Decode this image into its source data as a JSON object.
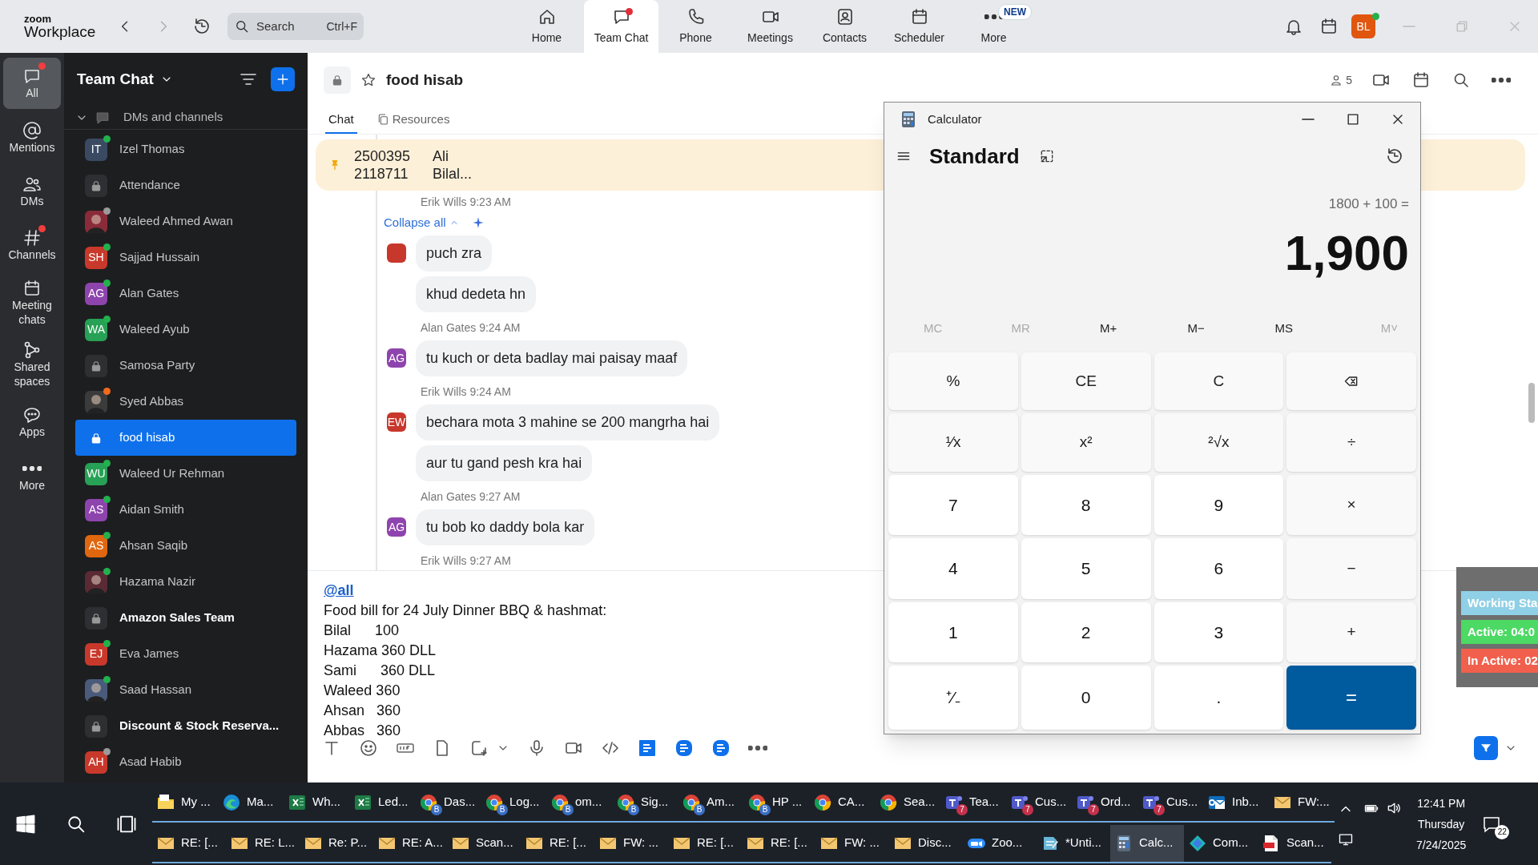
{
  "app": {
    "logo_top": "zoom",
    "logo_bottom": "Workplace",
    "search": {
      "placeholder": "Search",
      "shortcut": "Ctrl+F"
    }
  },
  "nav": [
    {
      "label": "Home",
      "selected": false,
      "dot": false
    },
    {
      "label": "Team Chat",
      "selected": true,
      "dot": true
    },
    {
      "label": "Phone",
      "selected": false,
      "dot": false
    },
    {
      "label": "Meetings",
      "selected": false,
      "dot": false
    },
    {
      "label": "Contacts",
      "selected": false,
      "dot": false
    },
    {
      "label": "Scheduler",
      "selected": false,
      "dot": false
    },
    {
      "label": "More",
      "selected": false,
      "dot": false,
      "badge": "NEW"
    }
  ],
  "account": {
    "initials": "BL"
  },
  "rail": [
    {
      "label": "All",
      "selected": true,
      "dot": true
    },
    {
      "label": "Mentions",
      "selected": false,
      "dot": false
    },
    {
      "label": "DMs",
      "selected": false,
      "dot": false
    },
    {
      "label": "Channels",
      "selected": false,
      "dot": true
    },
    {
      "label": "Meeting chats",
      "selected": false,
      "dot": false
    },
    {
      "label": "Shared spaces",
      "selected": false,
      "dot": false
    },
    {
      "label": "Apps",
      "selected": false,
      "dot": false
    },
    {
      "label": "More",
      "selected": false,
      "dot": false
    }
  ],
  "sidebar": {
    "title": "Team Chat",
    "section": "DMs and channels",
    "items": [
      {
        "name": "Izel Thomas",
        "kind": "initials",
        "initials": "IT",
        "color": "#3a4a63",
        "presence": {
          "color": "#22b14c"
        },
        "selected": false,
        "unread": false
      },
      {
        "name": "Attendance",
        "kind": "channel",
        "selected": false,
        "unread": false
      },
      {
        "name": "Waleed Ahmed Awan",
        "color": "#8a2b3a",
        "presence": {
          "color": "#9a9a9a"
        },
        "selected": false,
        "unread": false
      },
      {
        "name": "Sajjad Hussain",
        "kind": "initials",
        "initials": "SH",
        "color": "#c8392b",
        "presence": {
          "color": "#22b14c"
        },
        "selected": false,
        "unread": false
      },
      {
        "name": "Alan Gates",
        "kind": "initials",
        "initials": "AG",
        "color": "#8e44ad",
        "presence": {
          "color": "#22b14c"
        },
        "selected": false,
        "unread": false
      },
      {
        "name": "Waleed Ayub",
        "kind": "initials",
        "initials": "WA",
        "color": "#27a155",
        "presence": {
          "color": "#22b14c"
        },
        "selected": false,
        "unread": false
      },
      {
        "name": "Samosa Party",
        "kind": "channel",
        "selected": false,
        "unread": false
      },
      {
        "name": "Syed Abbas",
        "color": "#3b3b3b",
        "presence": {
          "color": "#f26a1b"
        },
        "selected": false,
        "unread": false
      },
      {
        "name": "food hisab",
        "kind": "channel",
        "selected": true,
        "unread": false
      },
      {
        "name": "Waleed Ur Rehman",
        "kind": "initials",
        "initials": "WU",
        "color": "#27a155",
        "presence": {
          "color": "#22b14c"
        },
        "selected": false,
        "unread": false
      },
      {
        "name": "Aidan Smith",
        "kind": "initials",
        "initials": "AS",
        "color": "#8e44ad",
        "presence": {
          "color": "#22b14c"
        },
        "selected": false,
        "unread": false
      },
      {
        "name": "Ahsan Saqib",
        "kind": "initials",
        "initials": "AS",
        "color": "#e0670f",
        "presence": {
          "color": "#22b14c"
        },
        "selected": false,
        "unread": false
      },
      {
        "name": "Hazama Nazir",
        "color": "#5a2a35",
        "presence": {
          "color": "#22b14c"
        },
        "selected": false,
        "unread": false
      },
      {
        "name": "Amazon Sales Team",
        "kind": "channel",
        "selected": false,
        "unread": true
      },
      {
        "name": "Eva James",
        "kind": "initials",
        "initials": "EJ",
        "color": "#c8392b",
        "presence": {
          "color": "#22b14c"
        },
        "selected": false,
        "unread": false
      },
      {
        "name": "Saad Hassan",
        "color": "#4a5a7a",
        "presence": {
          "color": "#22b14c"
        },
        "selected": false,
        "unread": false
      },
      {
        "name": "Discount & Stock Reserva...",
        "kind": "channel",
        "selected": false,
        "unread": true
      },
      {
        "name": "Asad Habib",
        "kind": "initials",
        "initials": "AH",
        "color": "#c8392b",
        "presence": {
          "color": "#9a9a9a"
        },
        "selected": false,
        "unread": false
      }
    ]
  },
  "channel": {
    "title": "food hisab",
    "members": "5",
    "tabs": [
      {
        "label": "Chat",
        "selected": true
      },
      {
        "label": "Resources",
        "selected": false
      }
    ],
    "pinned": [
      {
        "number": "2500395",
        "name": "Ali"
      },
      {
        "number": "2118711",
        "name": "Bilal..."
      }
    ],
    "collapse": "Collapse all",
    "messages": [
      {
        "sender": "Erik Wills",
        "time": "9:23 AM",
        "color": "#c8372c",
        "bubbles": [
          "puch zra",
          "khud dedeta hn"
        ]
      },
      {
        "sender": "Alan Gates",
        "time": "9:24 AM",
        "initials": "AG",
        "color": "#8e44ad",
        "bubbles": [
          "tu kuch or deta badlay mai paisay maaf"
        ]
      },
      {
        "sender": "Erik Wills",
        "time": "9:24 AM",
        "initials": "EW",
        "color": "#c8372c",
        "bubbles": [
          "bechara mota 3 mahine se 200 mangrha hai",
          "aur tu gand pesh kra hai"
        ]
      },
      {
        "sender": "Alan Gates",
        "time": "9:27 AM",
        "initials": "AG",
        "color": "#8e44ad",
        "bubbles": [
          "tu bob ko daddy bola kar"
        ]
      },
      {
        "sender": "Erik Wills",
        "time": "9:27 AM"
      }
    ],
    "composer": {
      "mention": "@all",
      "lines": [
        "Food bill for 24 July Dinner BBQ & hashmat:",
        "Bilal      100",
        "Hazama 360 DLL",
        "Sami      360 DLL",
        "Waleed 360",
        "Ahsan   360",
        "Abbas   360"
      ]
    }
  },
  "calculator": {
    "title": "Calculator",
    "mode": "Standard",
    "expression": "1800 + 100 =",
    "result": "1,900",
    "memory": [
      {
        "label": "MC",
        "disabled": true
      },
      {
        "label": "MR",
        "disabled": true
      },
      {
        "label": "M+",
        "disabled": false
      },
      {
        "label": "M−",
        "disabled": false
      },
      {
        "label": "MS",
        "disabled": false
      },
      {
        "label": "M˅",
        "disabled": true
      }
    ],
    "keys": [
      {
        "label": "%",
        "kind": "op"
      },
      {
        "label": "CE",
        "kind": "op"
      },
      {
        "label": "C",
        "kind": "op"
      },
      {
        "kind": "backspace"
      },
      {
        "label": "¹⁄x",
        "kind": "op"
      },
      {
        "label": "x²",
        "kind": "op"
      },
      {
        "label": "²√x",
        "kind": "op"
      },
      {
        "label": "÷",
        "kind": "op"
      },
      {
        "label": "7",
        "kind": "digit"
      },
      {
        "label": "8",
        "kind": "digit"
      },
      {
        "label": "9",
        "kind": "digit"
      },
      {
        "label": "×",
        "kind": "op"
      },
      {
        "label": "4",
        "kind": "digit"
      },
      {
        "label": "5",
        "kind": "digit"
      },
      {
        "label": "6",
        "kind": "digit"
      },
      {
        "label": "−",
        "kind": "op"
      },
      {
        "label": "1",
        "kind": "digit"
      },
      {
        "label": "2",
        "kind": "digit"
      },
      {
        "label": "3",
        "kind": "digit"
      },
      {
        "label": "+",
        "kind": "op"
      },
      {
        "label": "⁺⁄₋",
        "kind": "digit"
      },
      {
        "label": "0",
        "kind": "digit"
      },
      {
        "label": ".",
        "kind": "digit"
      },
      {
        "label": "=",
        "kind": "equals"
      }
    ]
  },
  "status_widget": [
    {
      "label": "Working Sta",
      "color": "#8fd0e6"
    },
    {
      "label": "Active: 04:0",
      "color": "#4cd964"
    },
    {
      "label": "In Active: 02",
      "color": "#f0604d"
    }
  ],
  "taskbar": {
    "row1": [
      {
        "label": "My ...",
        "kind": "folder",
        "selected": false
      },
      {
        "label": "Ma...",
        "kind": "edge",
        "selected": false
      },
      {
        "label": "Wh...",
        "kind": "excel",
        "selected": false
      },
      {
        "label": "Led...",
        "kind": "excel",
        "selected": false
      },
      {
        "label": "Das...",
        "kind": "chrome",
        "badge": "B",
        "selected": false
      },
      {
        "label": "Log...",
        "kind": "chrome",
        "badge": "B",
        "selected": false
      },
      {
        "label": "om...",
        "kind": "chrome",
        "badge": "B",
        "selected": false
      },
      {
        "label": "Sig...",
        "kind": "chrome",
        "badge": "B",
        "selected": false
      },
      {
        "label": "Am...",
        "kind": "chrome",
        "badge": "B",
        "selected": false
      },
      {
        "label": "HP ...",
        "kind": "chrome",
        "badge": "B",
        "selected": false
      },
      {
        "label": "CA...",
        "kind": "chrome",
        "selected": false
      },
      {
        "label": "Sea...",
        "kind": "chrome",
        "selected": false
      },
      {
        "label": "Tea...",
        "kind": "teams",
        "badge": "7",
        "selected": false
      },
      {
        "label": "Cus...",
        "kind": "teams",
        "badge": "7",
        "selected": false
      },
      {
        "label": "Ord...",
        "kind": "teams",
        "badge": "7",
        "selected": false
      },
      {
        "label": "Cus...",
        "kind": "teams",
        "badge": "7",
        "selected": false
      },
      {
        "label": "Inb...",
        "kind": "outlook",
        "selected": false
      },
      {
        "label": "FW:...",
        "kind": "mail",
        "selected": false
      }
    ],
    "row2": [
      {
        "label": "RE: [...",
        "kind": "mail",
        "selected": false
      },
      {
        "label": "RE: L...",
        "kind": "mail",
        "selected": false
      },
      {
        "label": "Re: P...",
        "kind": "mail",
        "selected": false
      },
      {
        "label": "RE: A...",
        "kind": "mail",
        "selected": false
      },
      {
        "label": "Scan...",
        "kind": "mail",
        "selected": false
      },
      {
        "label": "RE: [...",
        "kind": "mail",
        "selected": false
      },
      {
        "label": "FW: ...",
        "kind": "mail",
        "selected": false
      },
      {
        "label": "RE: [...",
        "kind": "mail",
        "selected": false
      },
      {
        "label": "RE: [...",
        "kind": "mail",
        "selected": false
      },
      {
        "label": "FW: ...",
        "kind": "mail",
        "selected": false
      },
      {
        "label": "Disc...",
        "kind": "mail",
        "selected": false
      },
      {
        "label": "Zoo...",
        "kind": "zoom",
        "selected": false
      },
      {
        "label": "*Unti...",
        "kind": "notepad",
        "selected": false
      },
      {
        "label": "Calc...",
        "kind": "calc",
        "selected": true
      },
      {
        "label": "Com...",
        "kind": "copilot",
        "selected": false
      },
      {
        "label": "Scan...",
        "kind": "pdf",
        "selected": false
      }
    ],
    "clock": {
      "time": "12:41 PM",
      "day": "Thursday",
      "date": "7/24/2025"
    },
    "notifications": "22"
  }
}
